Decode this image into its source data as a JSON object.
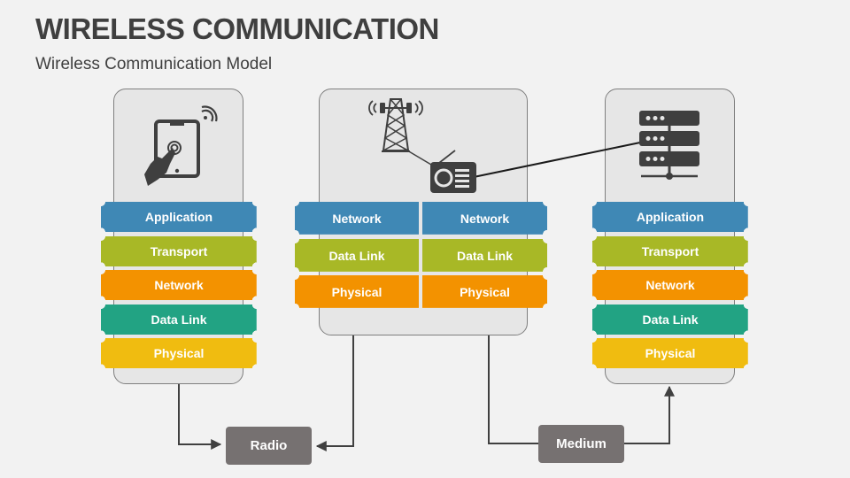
{
  "header": {
    "title": "WIRELESS COMMUNICATION",
    "subtitle": "Wireless Communication Model"
  },
  "colors": {
    "application": "#3f88b5",
    "transport": "#a8b826",
    "network": "#f39200",
    "data_link": "#22a383",
    "physical": "#f0bc10",
    "label_box": "#767171",
    "card_bg": "#e6e6e6",
    "icon": "#3f3f3f"
  },
  "left_stack": {
    "icon": "tablet-touch-wifi-icon",
    "layers": [
      {
        "label": "Application",
        "color_key": "application"
      },
      {
        "label": "Transport",
        "color_key": "transport"
      },
      {
        "label": "Network",
        "color_key": "network"
      },
      {
        "label": "Data Link",
        "color_key": "data_link"
      },
      {
        "label": "Physical",
        "color_key": "physical"
      }
    ]
  },
  "middle_stack": {
    "icons": [
      "radio-tower-icon",
      "radio-icon"
    ],
    "left_column": [
      {
        "label": "Network",
        "color_key": "application"
      },
      {
        "label": "Data Link",
        "color_key": "transport"
      },
      {
        "label": "Physical",
        "color_key": "network"
      }
    ],
    "right_column": [
      {
        "label": "Network",
        "color_key": "application"
      },
      {
        "label": "Data Link",
        "color_key": "transport"
      },
      {
        "label": "Physical",
        "color_key": "network"
      }
    ]
  },
  "right_stack": {
    "icon": "server-rack-icon",
    "layers": [
      {
        "label": "Application",
        "color_key": "application"
      },
      {
        "label": "Transport",
        "color_key": "transport"
      },
      {
        "label": "Network",
        "color_key": "network"
      },
      {
        "label": "Data Link",
        "color_key": "data_link"
      },
      {
        "label": "Physical",
        "color_key": "physical"
      }
    ]
  },
  "connectors": {
    "radio_label": "Radio",
    "medium_label": "Medium"
  }
}
